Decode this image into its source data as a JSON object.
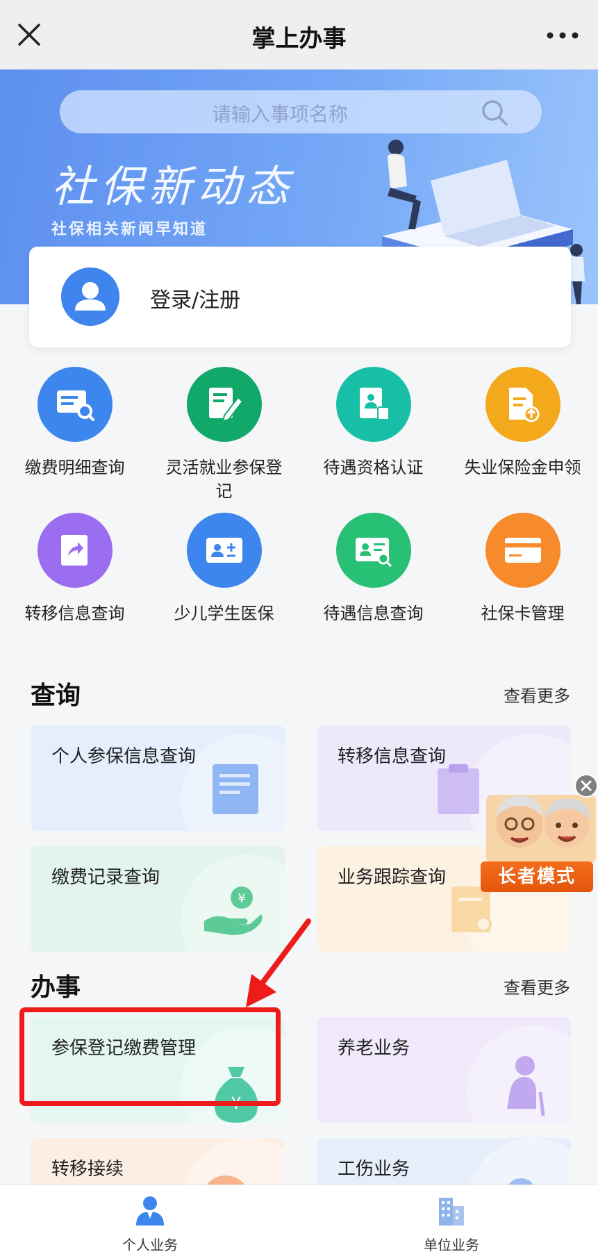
{
  "titlebar": {
    "title": "掌上办事"
  },
  "banner": {
    "search_placeholder": "请输入事项名称",
    "title": "社保新动态",
    "subtitle": "社保相关新闻早知道"
  },
  "login": {
    "label": "登录/注册"
  },
  "quick": [
    {
      "label": "缴费明细查询",
      "color": "#3d86ee",
      "icon": "payment-detail-icon"
    },
    {
      "label": "灵活就业参保登记",
      "color": "#12a86a",
      "icon": "flexible-register-icon"
    },
    {
      "label": "待遇资格认证",
      "color": "#17bfa6",
      "icon": "qualification-icon"
    },
    {
      "label": "失业保险金申领",
      "color": "#f4a81c",
      "icon": "unemployment-icon"
    },
    {
      "label": "转移信息查询",
      "color": "#9b6df0",
      "icon": "transfer-icon"
    },
    {
      "label": "少儿学生医保",
      "color": "#3d86ee",
      "icon": "student-medical-icon"
    },
    {
      "label": "待遇信息查询",
      "color": "#27c075",
      "icon": "benefit-info-icon"
    },
    {
      "label": "社保卡管理",
      "color": "#f78a2a",
      "icon": "card-icon"
    }
  ],
  "query": {
    "title": "查询",
    "more": "查看更多",
    "cards": [
      {
        "label": "个人参保信息查询",
        "color": "#e4eefc"
      },
      {
        "label": "转移信息查询",
        "color": "#eee8fb"
      },
      {
        "label": "缴费记录查询",
        "color": "#e2f4ec"
      },
      {
        "label": "业务跟踪查询",
        "color": "#fdf1e1"
      }
    ]
  },
  "affairs": {
    "title": "办事",
    "more": "查看更多",
    "cards": [
      {
        "label": "参保登记缴费管理",
        "color": "#e3f6f0"
      },
      {
        "label": "养老业务",
        "color": "#efe9fb"
      },
      {
        "label": "转移接续",
        "color": "#fdeee4"
      },
      {
        "label": "工伤业务",
        "color": "#e6eefc"
      }
    ]
  },
  "elder": {
    "label": "长者模式"
  },
  "nav": [
    {
      "label": "个人业务",
      "icon": "person-business-icon"
    },
    {
      "label": "单位业务",
      "icon": "company-business-icon"
    }
  ]
}
